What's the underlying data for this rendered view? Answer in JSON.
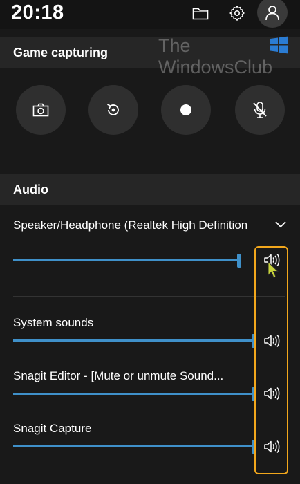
{
  "status": {
    "time": "20:18"
  },
  "icons": {
    "folder": "folder-icon",
    "settings": "gear-icon",
    "profile": "person-icon"
  },
  "watermark": {
    "line1": "The",
    "line2": "WindowsClub"
  },
  "game_capturing": {
    "title": "Game capturing",
    "buttons": [
      {
        "name": "screenshot",
        "icon": "camera-icon"
      },
      {
        "name": "record-last",
        "icon": "replay-icon"
      },
      {
        "name": "record",
        "icon": "record-dot-icon"
      },
      {
        "name": "mic",
        "icon": "mic-muted-icon"
      }
    ]
  },
  "audio": {
    "title": "Audio",
    "device": {
      "label": "Speaker/Headphone (Realtek High Definition",
      "volume": 0.9
    },
    "apps": [
      {
        "label": "System sounds",
        "volume": 1.0
      },
      {
        "label": "Snagit Editor - [Mute or unmute Sound...",
        "volume": 1.0
      },
      {
        "label": "Snagit Capture",
        "volume": 1.0
      }
    ]
  },
  "colors": {
    "accent": "#3f90c9",
    "highlight": "#f2a71c",
    "cursor": "#c8d43a"
  }
}
